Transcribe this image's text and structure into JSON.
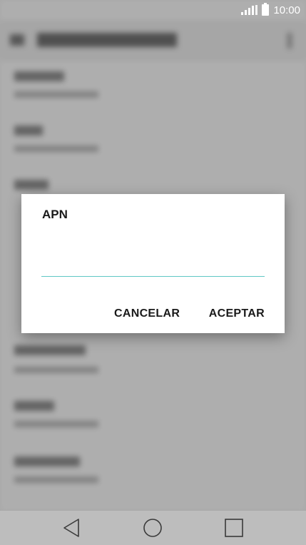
{
  "status_bar": {
    "time": "10:00",
    "signal_icon": "signal-icon",
    "battery_icon": "battery-icon"
  },
  "dialog": {
    "title": "APN",
    "input_value": "",
    "cancel_label": "CANCELAR",
    "ok_label": "ACEPTAR"
  },
  "nav_bar": {
    "back_icon": "back-triangle-icon",
    "home_icon": "home-circle-icon",
    "recents_icon": "recents-square-icon"
  },
  "colors": {
    "accent": "#5fc8c4",
    "dialog_bg": "#ffffff",
    "nav_bg": "#bdbdbd"
  }
}
